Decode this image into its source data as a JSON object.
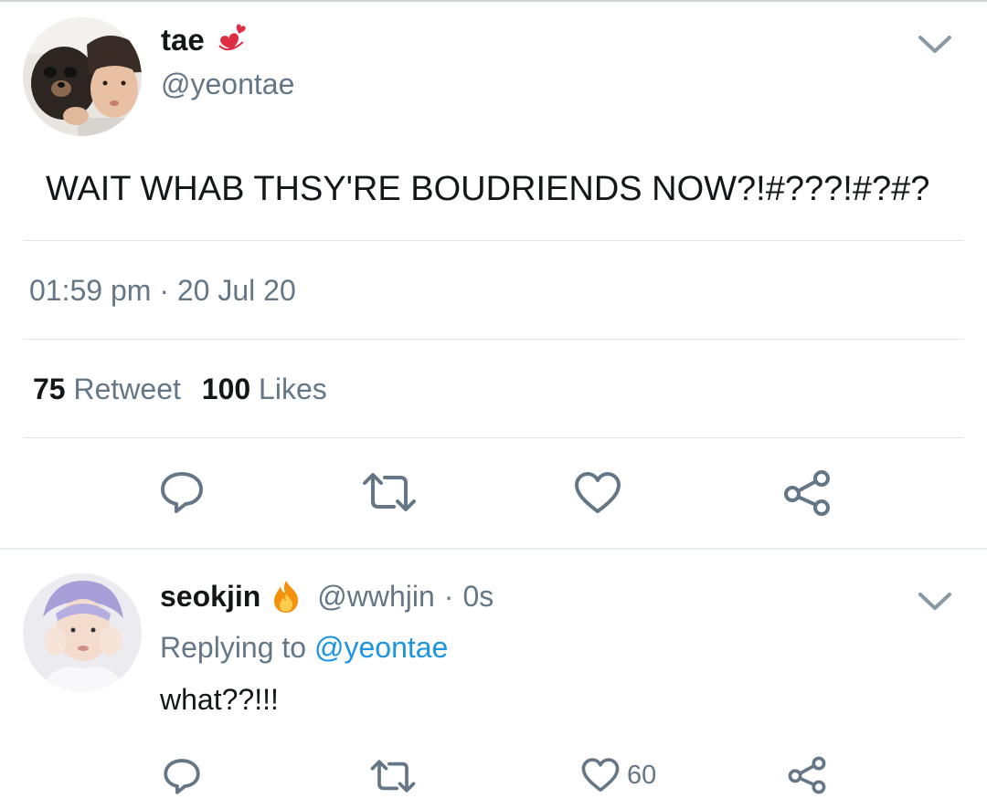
{
  "main_tweet": {
    "author_name": "tae",
    "author_emoji": "revolving-hearts-icon",
    "handle": "@yeontae",
    "text": "WAIT WHAB THSY'RE BOUDRIENDS NOW?!#???!#?#?",
    "time": "01:59 pm",
    "separator": "·",
    "date": "20 Jul 20",
    "retweet_count": "75",
    "retweet_label": "Retweet",
    "like_count": "100",
    "like_label": "Likes"
  },
  "reply": {
    "author_name": "seokjin",
    "author_emoji": "fire-icon",
    "handle": "@wwhjin",
    "separator": "·",
    "age": "0s",
    "replying_prefix": "Replying to",
    "replying_to": "@yeontae",
    "text": "what??!!!",
    "like_count": "60"
  },
  "colors": {
    "text_primary": "#14171a",
    "text_secondary": "#657786",
    "link": "#1b95e0",
    "divider": "#e1e8ed"
  }
}
